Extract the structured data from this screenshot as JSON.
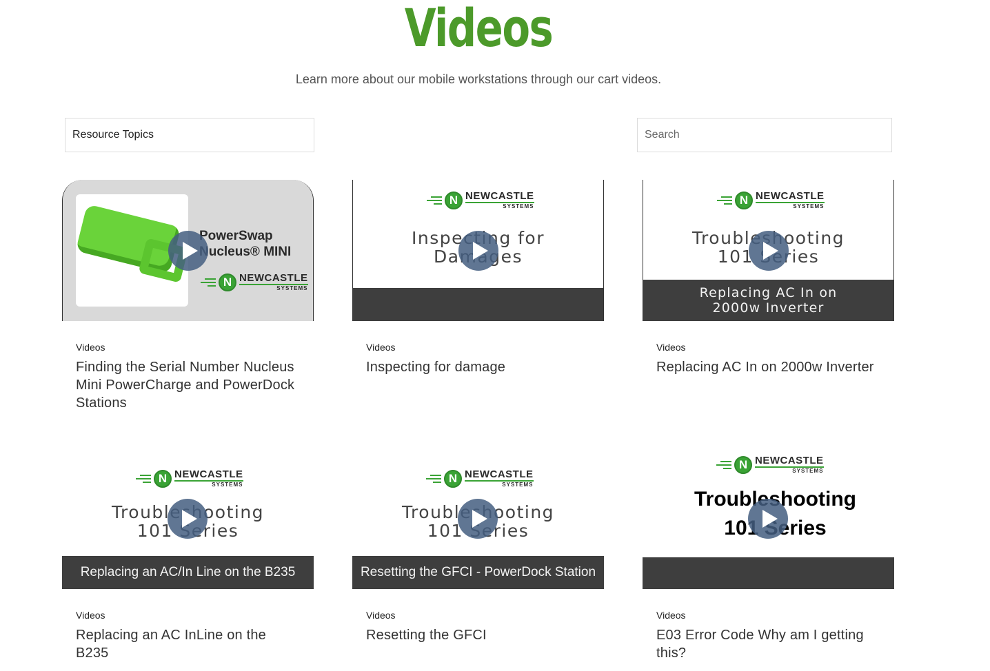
{
  "header": {
    "title": "Videos",
    "subtitle": "Learn more about our mobile workstations through our cart videos."
  },
  "filters": {
    "topics_label": "Resource Topics",
    "search_placeholder": "Search"
  },
  "brand": {
    "name": "NEWCASTLE",
    "sub": "SYSTEMS",
    "badge": "N"
  },
  "colors": {
    "title_green": "#4c9a2a",
    "brand_green": "#3aa335",
    "bar_dark": "#3e3e3e",
    "play_blue": "#445e80"
  },
  "cards": [
    {
      "category": "Videos",
      "title": "Finding the Serial Number Nucleus Mini PowerCharge and PowerDock Stations",
      "thumb_line1": "PowerSwap",
      "thumb_line2": "Nucleus® MINI"
    },
    {
      "category": "Videos",
      "title": "Inspecting for damage",
      "thumb_line1": "Inspecting for",
      "thumb_line2": "Damages"
    },
    {
      "category": "Videos",
      "title": "Replacing AC In on 2000w Inverter",
      "thumb_line1": "Troubleshooting",
      "thumb_line2": "101 Series",
      "thumb_bar1": "Replacing AC In on",
      "thumb_bar2": "2000w Inverter"
    },
    {
      "category": "Videos",
      "title": "Replacing an AC InLine on the B235",
      "thumb_line1": "Troubleshooting",
      "thumb_line2": "101 Series",
      "thumb_bar": "Replacing an AC/In Line on the B235"
    },
    {
      "category": "Videos",
      "title": "Resetting the GFCI",
      "thumb_line1": "Troubleshooting",
      "thumb_line2": "101 Series",
      "thumb_bar": "Resetting the GFCI - PowerDock Station"
    },
    {
      "category": "Videos",
      "title": "E03 Error Code Why am I getting this?",
      "thumb_line1": "Troubleshooting",
      "thumb_line2": "101 Series"
    }
  ]
}
